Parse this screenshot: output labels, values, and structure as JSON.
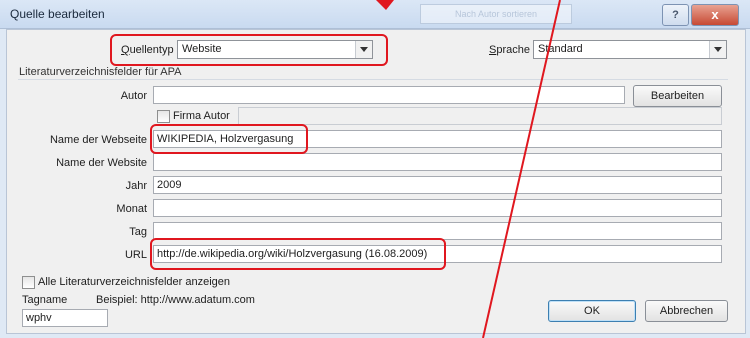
{
  "dialog": {
    "title": "Quelle bearbeiten",
    "ghost_text": "Nach Autor sortieren"
  },
  "header": {
    "source_type_label": "Quellentyp",
    "source_type_value": "Website",
    "language_label": "Sprache",
    "language_value": "Standard"
  },
  "group_title": "Literaturverzeichnisfelder für APA",
  "fields": {
    "author": {
      "label": "Autor",
      "value": "",
      "edit_button": "Bearbeiten",
      "corporate_label": "Firma Autor"
    },
    "site_name": {
      "label": "Name der Webseite",
      "value": "WIKIPEDIA, Holzvergasung"
    },
    "website_name": {
      "label": "Name der Website",
      "value": ""
    },
    "year": {
      "label": "Jahr",
      "value": "2009"
    },
    "month": {
      "label": "Monat",
      "value": ""
    },
    "day": {
      "label": "Tag",
      "value": ""
    },
    "url": {
      "label": "URL",
      "value": "http://de.wikipedia.org/wiki/Holzvergasung (16.08.2009)"
    }
  },
  "footer": {
    "show_all_label": "Alle Literaturverzeichnisfelder anzeigen",
    "tag_label": "Tagname",
    "example_text": "Beispiel: http://www.adatum.com",
    "tag_value": "wphv",
    "ok_label": "OK",
    "cancel_label": "Abbrechen"
  },
  "titlebar_buttons": {
    "help": "?",
    "close": "x"
  },
  "colors": {
    "highlight": "#e0171f",
    "titlebar": "#c9daf0",
    "background": "#f0f0f0"
  }
}
